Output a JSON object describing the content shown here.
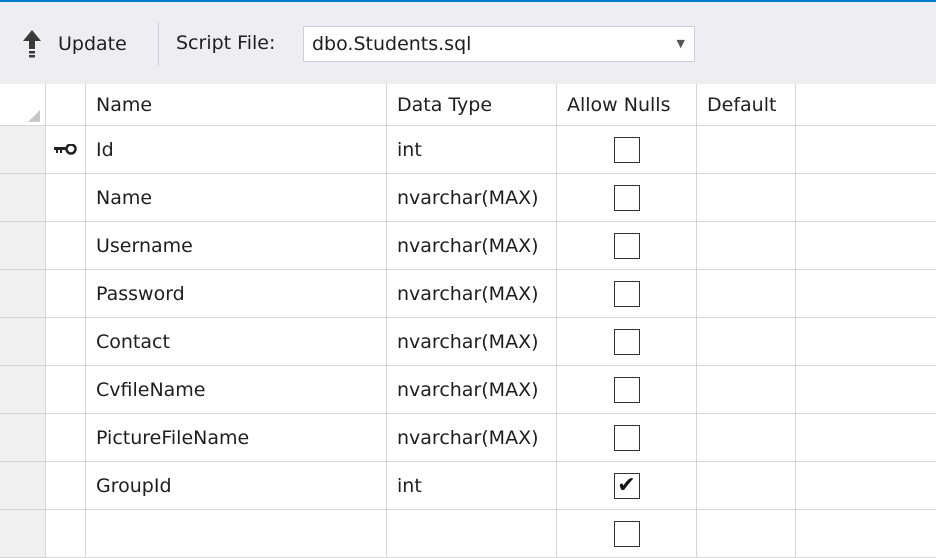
{
  "toolbar": {
    "update_label": "Update",
    "script_file_label": "Script File:",
    "script_file_value": "dbo.Students.sql"
  },
  "columns": {
    "name": "Name",
    "data_type": "Data Type",
    "allow_nulls": "Allow Nulls",
    "default": "Default"
  },
  "rows": [
    {
      "name": "Id",
      "type": "int",
      "allow_nulls": false,
      "primary_key": true
    },
    {
      "name": "Name",
      "type": "nvarchar(MAX)",
      "allow_nulls": false
    },
    {
      "name": "Username",
      "type": "nvarchar(MAX)",
      "allow_nulls": false
    },
    {
      "name": "Password",
      "type": "nvarchar(MAX)",
      "allow_nulls": false
    },
    {
      "name": "Contact",
      "type": "nvarchar(MAX)",
      "allow_nulls": false
    },
    {
      "name": "CvfileName",
      "type": "nvarchar(MAX)",
      "allow_nulls": false
    },
    {
      "name": "PictureFileName",
      "type": "nvarchar(MAX)",
      "allow_nulls": false
    },
    {
      "name": "GroupId",
      "type": "int",
      "allow_nulls": true
    },
    {
      "name": "",
      "type": "",
      "allow_nulls": false
    }
  ],
  "icons": {
    "update": "upload-arrow-icon",
    "primary_key": "key-icon",
    "combo": "chevron-down-icon"
  },
  "colors": {
    "accent": "#007acc",
    "toolbar_bg": "#eeeef2",
    "row_header_bg": "#f0f0f0",
    "grid_line": "#d5d5d5"
  }
}
